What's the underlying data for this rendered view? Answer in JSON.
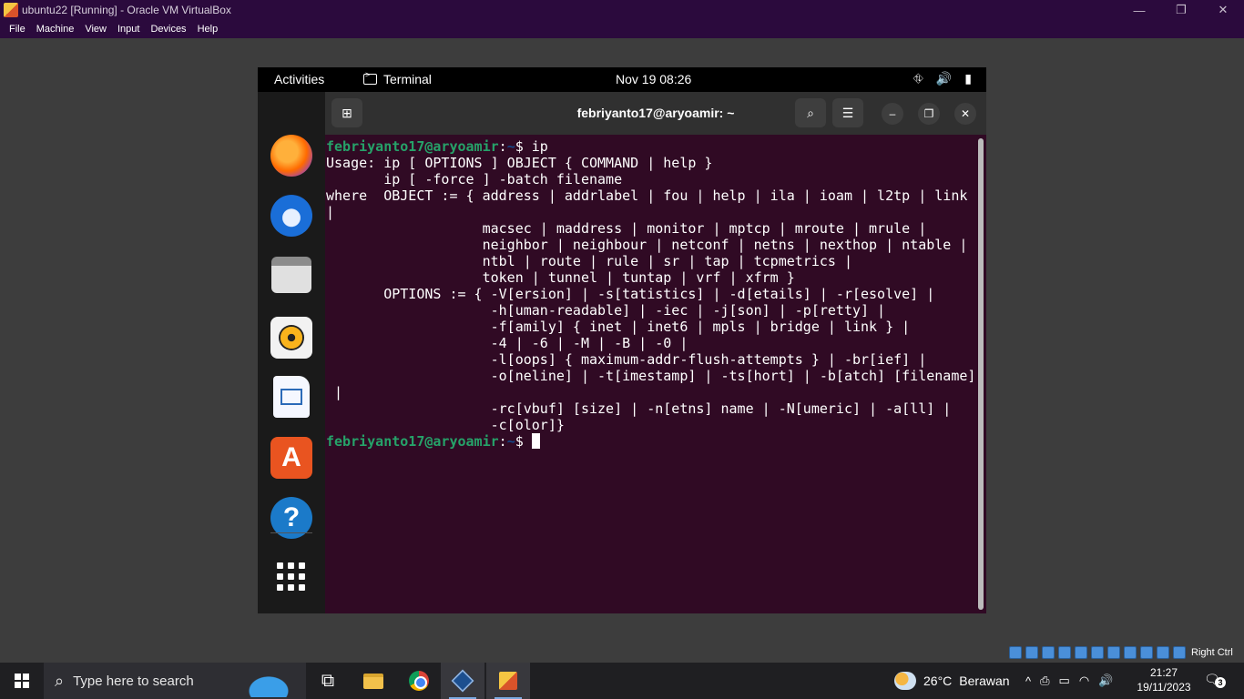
{
  "vbox": {
    "title": "ubuntu22 [Running] - Oracle VM VirtualBox",
    "menu": [
      "File",
      "Machine",
      "View",
      "Input",
      "Devices",
      "Help"
    ],
    "window_controls": {
      "minimize": "—",
      "restore": "❐",
      "close": "✕"
    },
    "host_key": "Right Ctrl"
  },
  "ubuntu": {
    "topbar": {
      "activities": "Activities",
      "app_name": "Terminal",
      "clock": "Nov 19  08:26",
      "tray": {
        "network": "⛗",
        "volume": "🔊",
        "battery": "▮"
      }
    },
    "dock": [
      {
        "name": "firefox-icon"
      },
      {
        "name": "thunderbird-icon"
      },
      {
        "name": "files-icon"
      },
      {
        "name": "rhythmbox-icon"
      },
      {
        "name": "libreoffice-writer-icon"
      },
      {
        "name": "app-center-icon",
        "glyph": "A"
      },
      {
        "name": "help-icon",
        "glyph": "?"
      },
      {
        "name": "show-apps-icon"
      }
    ]
  },
  "terminal": {
    "title": "febriyanto17@aryoamir: ~",
    "prompt_user": "febriyanto17@aryoamir",
    "prompt_path": "~",
    "command": "ip",
    "output": "Usage: ip [ OPTIONS ] OBJECT { COMMAND | help }\n       ip [ -force ] -batch filename\nwhere  OBJECT := { address | addrlabel | fou | help | ila | ioam | l2tp | link\n|\n                   macsec | maddress | monitor | mptcp | mroute | mrule |\n                   neighbor | neighbour | netconf | netns | nexthop | ntable |\n                   ntbl | route | rule | sr | tap | tcpmetrics |\n                   token | tunnel | tuntap | vrf | xfrm }\n       OPTIONS := { -V[ersion] | -s[tatistics] | -d[etails] | -r[esolve] |\n                    -h[uman-readable] | -iec | -j[son] | -p[retty] |\n                    -f[amily] { inet | inet6 | mpls | bridge | link } |\n                    -4 | -6 | -M | -B | -0 |\n                    -l[oops] { maximum-addr-flush-attempts } | -br[ief] |\n                    -o[neline] | -t[imestamp] | -ts[hort] | -b[atch] [filename]\n |\n                    -rc[vbuf] [size] | -n[etns] name | -N[umeric] | -a[ll] |\n                    -c[olor]}"
  },
  "taskbar": {
    "search_placeholder": "Type here to search",
    "weather": {
      "temp": "26°C",
      "condition": "Berawan"
    },
    "tray_icons": [
      "^",
      "⎙",
      "▭",
      "◠",
      "🔊"
    ],
    "time": "21:27",
    "date": "19/11/2023",
    "notifications": "3"
  }
}
